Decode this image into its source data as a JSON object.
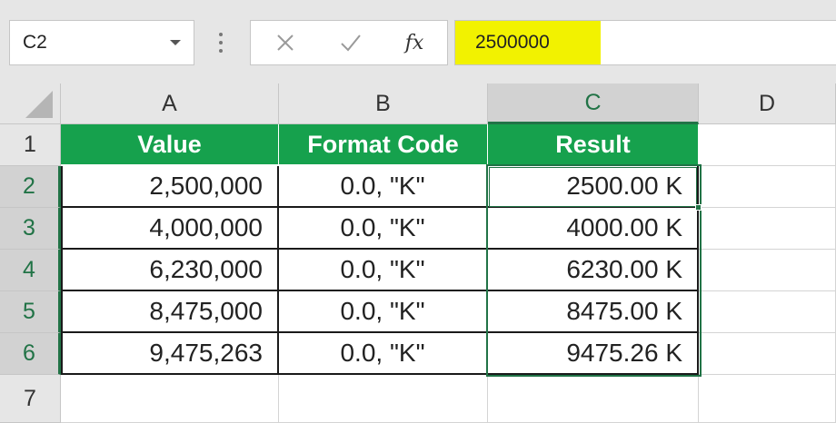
{
  "name_box": {
    "value": "C2"
  },
  "formula_bar": {
    "value": "2500000",
    "highlight_color": "#f2f200"
  },
  "icons": {
    "cancel": "x-icon",
    "enter": "checkmark-icon",
    "insert_function": "fx-icon"
  },
  "insert_function_label": "fx",
  "columns": [
    "A",
    "B",
    "C",
    "D"
  ],
  "rows": [
    "1",
    "2",
    "3",
    "4",
    "5",
    "6",
    "7"
  ],
  "table": {
    "header_color": "#16a14d",
    "headers": [
      "Value",
      "Format Code",
      "Result"
    ],
    "data": [
      [
        "2,500,000",
        "0.0, \"K\"",
        "2500.00 K"
      ],
      [
        "4,000,000",
        "0.0, \"K\"",
        "4000.00 K"
      ],
      [
        "6,230,000",
        "0.0, \"K\"",
        "6230.00 K"
      ],
      [
        "8,475,000",
        "0.0, \"K\"",
        "8475.00 K"
      ],
      [
        "9,475,263",
        "0.0, \"K\"",
        "9475.26 K"
      ]
    ]
  },
  "selection": {
    "active_cell": "C2",
    "range": "C2:C6",
    "accent_color": "#217346"
  }
}
